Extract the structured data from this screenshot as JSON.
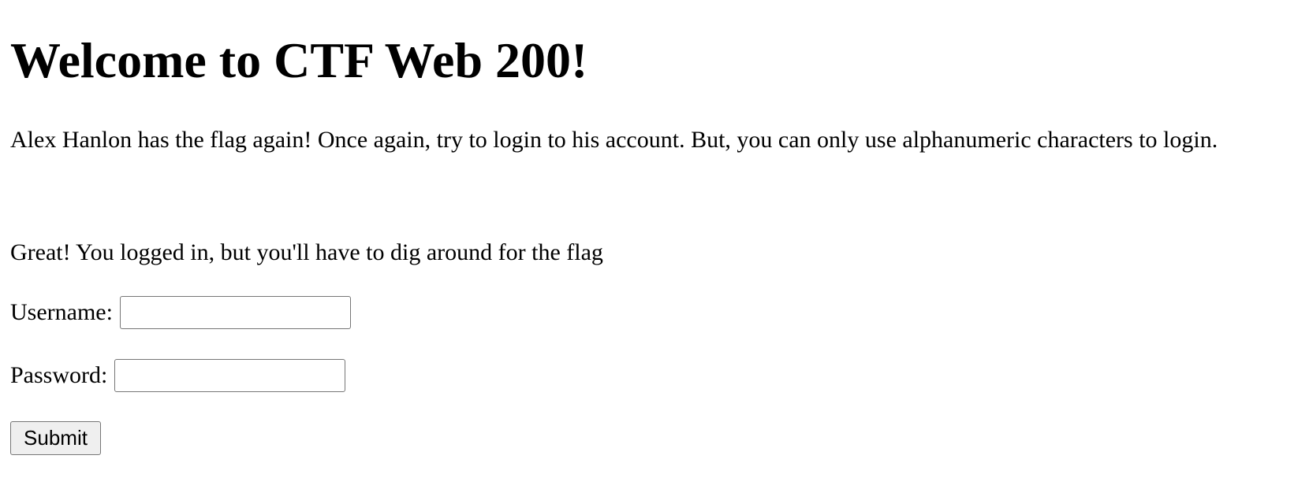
{
  "page": {
    "title": "Welcome to CTF Web 200!",
    "intro": "Alex Hanlon has the flag again! Once again, try to login to his account. But, you can only use alphanumeric characters to login.",
    "status_message": "Great! You logged in, but you'll have to dig around for the flag"
  },
  "form": {
    "username_label": "Username:",
    "username_value": "",
    "password_label": "Password:",
    "password_value": "",
    "submit_label": "Submit"
  }
}
